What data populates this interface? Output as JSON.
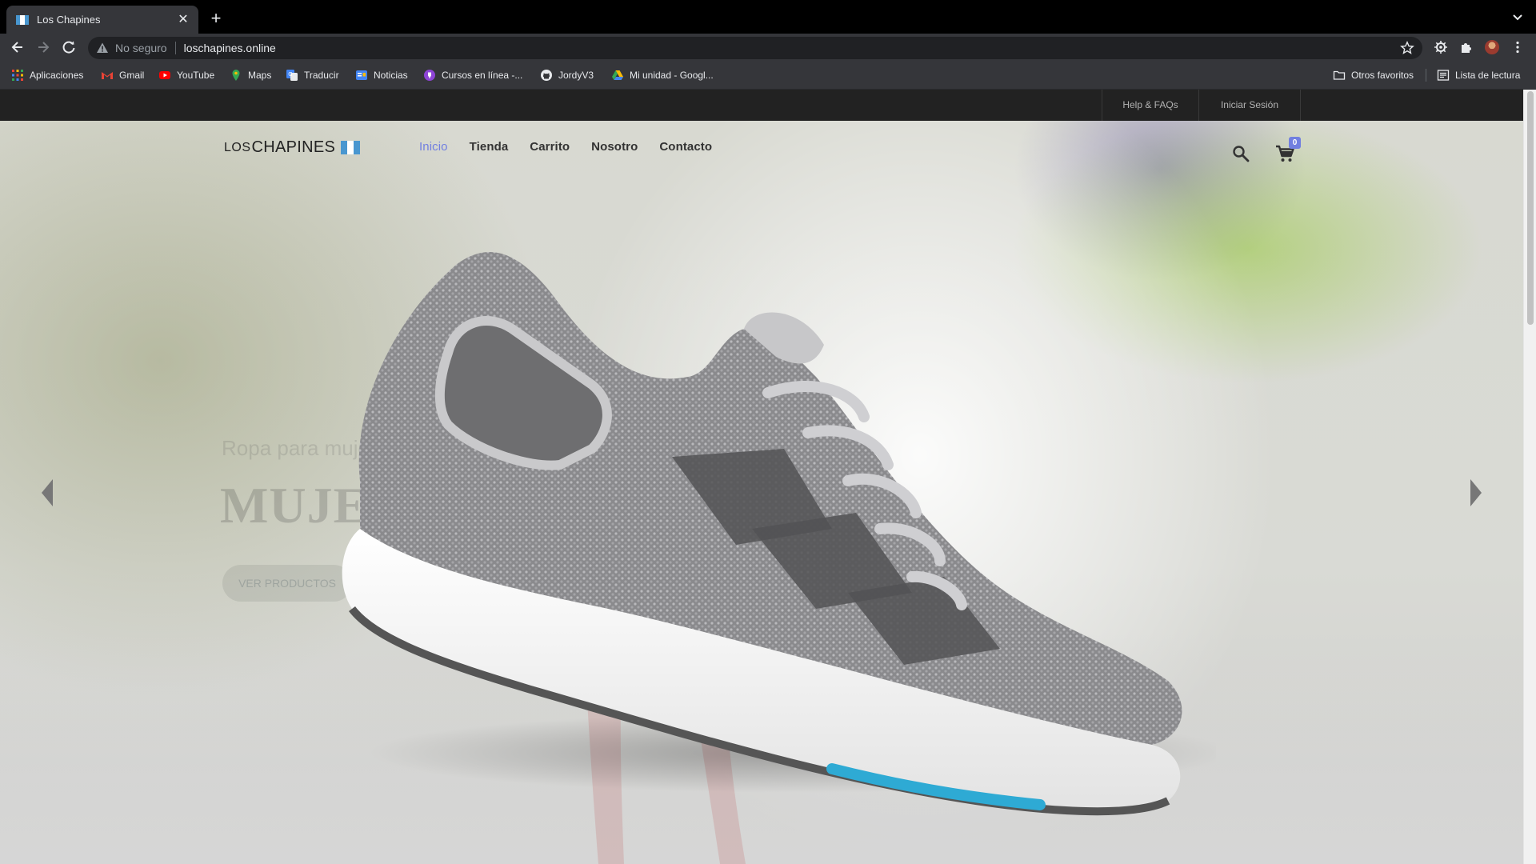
{
  "browser": {
    "tab": {
      "title": "Los Chapines"
    },
    "address": {
      "security_label": "No seguro",
      "url": "loschapines.online"
    },
    "bookmarks": [
      {
        "label": "Aplicaciones",
        "icon": "apps-grid-icon"
      },
      {
        "label": "Gmail",
        "icon": "gmail-icon"
      },
      {
        "label": "YouTube",
        "icon": "youtube-icon"
      },
      {
        "label": "Maps",
        "icon": "maps-icon"
      },
      {
        "label": "Traducir",
        "icon": "translate-icon"
      },
      {
        "label": "Noticias",
        "icon": "news-icon"
      },
      {
        "label": "Cursos en línea -...",
        "icon": "courses-icon"
      },
      {
        "label": "JordyV3",
        "icon": "github-icon"
      },
      {
        "label": "Mi unidad - Googl...",
        "icon": "drive-icon"
      }
    ],
    "bookmarks_right": {
      "other_favorites": "Otros favoritos",
      "reading_list": "Lista de lectura"
    }
  },
  "site": {
    "topbar": {
      "help": "Help & FAQs",
      "login": "Iniciar Sesión"
    },
    "logo": {
      "part1": "LOS",
      "part2": "CHAPINES"
    },
    "nav": [
      {
        "label": "Inicio",
        "active": true
      },
      {
        "label": "Tienda"
      },
      {
        "label": "Carrito"
      },
      {
        "label": "Nosotro"
      },
      {
        "label": "Contacto"
      }
    ],
    "cart_count": "0",
    "slide": {
      "subtitle": "Ropa para mujer",
      "title": "MUJER",
      "button": "VER PRODUCTOS"
    }
  },
  "colors": {
    "accent": "#717fe0",
    "topbar_bg": "#222222",
    "chrome_bg": "#35363a"
  }
}
